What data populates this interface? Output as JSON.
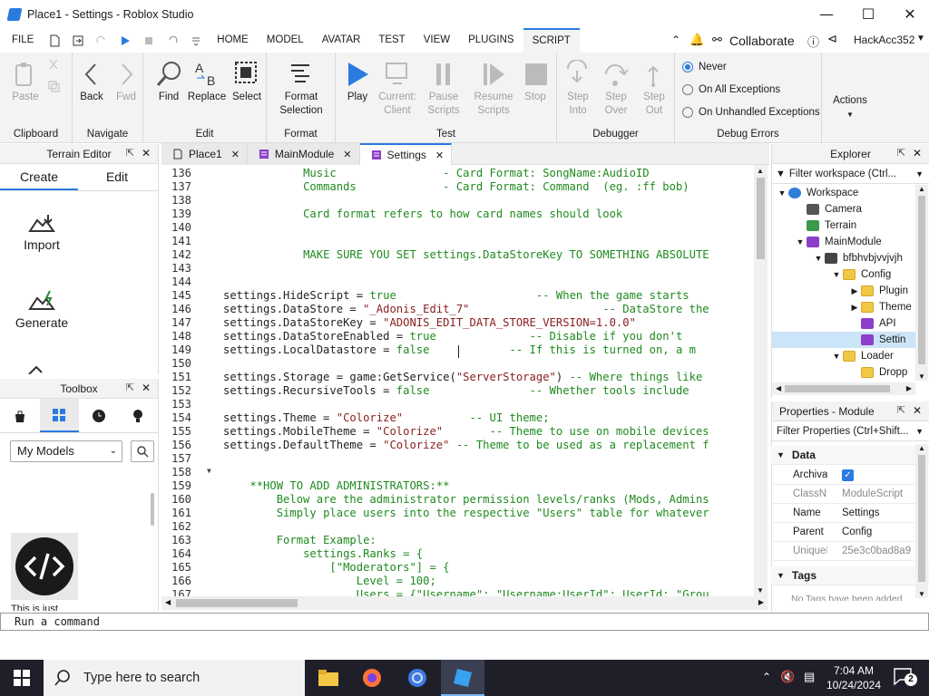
{
  "window": {
    "title": "Place1 - Settings - Roblox Studio"
  },
  "menubar": {
    "file": "FILE",
    "tabs": [
      "HOME",
      "MODEL",
      "AVATAR",
      "TEST",
      "VIEW",
      "PLUGINS",
      "SCRIPT"
    ],
    "active_tab": "SCRIPT",
    "collaborate": "Collaborate",
    "user": "HackAcc352"
  },
  "ribbon": {
    "paste": "Paste",
    "clipboard": "Clipboard",
    "back": "Back",
    "fwd": "Fwd",
    "navigate": "Navigate",
    "find": "Find",
    "replace": "Replace",
    "select": "Select",
    "edit": "Edit",
    "format_selection_1": "Format",
    "format_selection_2": "Selection",
    "format": "Format",
    "play": "Play",
    "current_client_1": "Current:",
    "current_client_2": "Client",
    "pause_scripts_1": "Pause",
    "pause_scripts_2": "Scripts",
    "resume_scripts_1": "Resume",
    "resume_scripts_2": "Scripts",
    "stop": "Stop",
    "test": "Test",
    "step_into_1": "Step",
    "step_into_2": "Into",
    "step_over_1": "Step",
    "step_over_2": "Over",
    "step_out_1": "Step",
    "step_out_2": "Out",
    "debugger": "Debugger",
    "never": "Never",
    "on_all": "On All Exceptions",
    "on_unhandled": "On Unhandled Exceptions",
    "debug_errors": "Debug Errors",
    "actions": "Actions"
  },
  "terrain": {
    "title": "Terrain Editor",
    "tab_create": "Create",
    "tab_edit": "Edit",
    "import": "Import",
    "generate": "Generate"
  },
  "toolbox": {
    "title": "Toolbox",
    "dropdown": "My Models",
    "item_caption": "This is just"
  },
  "doctabs": [
    "Place1",
    "MainModule",
    "Settings"
  ],
  "editor": {
    "lines": [
      {
        "n": "136",
        "parts": [
          [
            "pl",
            "            "
          ],
          [
            "cm",
            "Music                - Card Format: SongName:AudioID"
          ]
        ]
      },
      {
        "n": "137",
        "parts": [
          [
            "pl",
            "            "
          ],
          [
            "cm",
            "Commands             - Card Format: Command  (eg. :ff bob)"
          ]
        ]
      },
      {
        "n": "138",
        "parts": []
      },
      {
        "n": "139",
        "parts": [
          [
            "pl",
            "            "
          ],
          [
            "cm",
            "Card format refers to how card names should look"
          ]
        ]
      },
      {
        "n": "140",
        "parts": []
      },
      {
        "n": "141",
        "parts": []
      },
      {
        "n": "142",
        "parts": [
          [
            "pl",
            "            "
          ],
          [
            "cm",
            "MAKE SURE YOU SET settings.DataStoreKey TO SOMETHING ABSOLUTE"
          ]
        ]
      },
      {
        "n": "143",
        "parts": []
      },
      {
        "n": "144",
        "parts": []
      },
      {
        "n": "145",
        "parts": [
          [
            "pl",
            "settings.HideScript = "
          ],
          [
            "kw",
            "true"
          ],
          [
            "cm",
            "                     -- When the game starts"
          ]
        ]
      },
      {
        "n": "146",
        "parts": [
          [
            "pl",
            "settings.DataStore = "
          ],
          [
            "str",
            "\"_Adonis_Edit_7\""
          ],
          [
            "cm",
            "                    -- DataStore the"
          ]
        ]
      },
      {
        "n": "147",
        "parts": [
          [
            "pl",
            "settings.DataStoreKey = "
          ],
          [
            "str",
            "\"ADONIS_EDIT_DATA_STORE_VERSION=1.0.0\""
          ]
        ]
      },
      {
        "n": "148",
        "parts": [
          [
            "pl",
            "settings.DataStoreEnabled = "
          ],
          [
            "kw",
            "true"
          ],
          [
            "cm",
            "              -- Disable if you don't"
          ]
        ]
      },
      {
        "n": "149",
        "parts": [
          [
            "pl",
            "settings.LocalDatastore = "
          ],
          [
            "kw",
            "false"
          ],
          [
            "cm",
            "            -- If this is turned on, a m"
          ]
        ]
      },
      {
        "n": "150",
        "parts": []
      },
      {
        "n": "151",
        "parts": [
          [
            "pl",
            "settings.Storage = game:GetService("
          ],
          [
            "str",
            "\"ServerStorage\""
          ],
          [
            "pl",
            ")"
          ],
          [
            "cm",
            " -- Where things like"
          ]
        ]
      },
      {
        "n": "152",
        "parts": [
          [
            "pl",
            "settings.RecursiveTools = "
          ],
          [
            "kw",
            "false"
          ],
          [
            "cm",
            "               -- Whether tools include"
          ]
        ]
      },
      {
        "n": "153",
        "parts": []
      },
      {
        "n": "154",
        "parts": [
          [
            "pl",
            "settings.Theme = "
          ],
          [
            "str",
            "\"Colorize\""
          ],
          [
            "cm",
            "          -- UI theme;"
          ]
        ]
      },
      {
        "n": "155",
        "parts": [
          [
            "pl",
            "settings.MobileTheme = "
          ],
          [
            "str",
            "\"Colorize\""
          ],
          [
            "cm",
            "       -- Theme to use on mobile devices"
          ]
        ]
      },
      {
        "n": "156",
        "parts": [
          [
            "pl",
            "settings.DefaultTheme = "
          ],
          [
            "str",
            "\"Colorize\""
          ],
          [
            "cm",
            " -- Theme to be used as a replacement f"
          ]
        ]
      },
      {
        "n": "157",
        "parts": []
      },
      {
        "n": "158",
        "parts": []
      },
      {
        "n": "159",
        "parts": [
          [
            "pl",
            "    "
          ],
          [
            "cm",
            "**HOW TO ADD ADMINISTRATORS:**"
          ]
        ]
      },
      {
        "n": "160",
        "parts": [
          [
            "pl",
            "        "
          ],
          [
            "cm",
            "Below are the administrator permission levels/ranks (Mods, Admins"
          ]
        ]
      },
      {
        "n": "161",
        "parts": [
          [
            "pl",
            "        "
          ],
          [
            "cm",
            "Simply place users into the respective \"Users\" table for whatever"
          ]
        ]
      },
      {
        "n": "162",
        "parts": []
      },
      {
        "n": "163",
        "parts": [
          [
            "pl",
            "        "
          ],
          [
            "cm",
            "Format Example:"
          ]
        ]
      },
      {
        "n": "164",
        "parts": [
          [
            "pl",
            "            "
          ],
          [
            "cm",
            "settings.Ranks = {"
          ]
        ]
      },
      {
        "n": "165",
        "parts": [
          [
            "pl",
            "                "
          ],
          [
            "cm",
            "[\"Moderators\"] = {"
          ]
        ]
      },
      {
        "n": "166",
        "parts": [
          [
            "pl",
            "                    "
          ],
          [
            "cm",
            "Level = 100;"
          ]
        ]
      },
      {
        "n": "167",
        "parts": [
          [
            "pl",
            "                    "
          ],
          [
            "cm",
            "Users = {\"Username\"; \"Username:UserId\"; UserId; \"Grou"
          ]
        ]
      }
    ]
  },
  "explorer": {
    "title": "Explorer",
    "filter": "Filter workspace (Ctrl...",
    "items": [
      "Workspace",
      "Camera",
      "Terrain",
      "MainModule",
      "bfbhvbjvvjvjh",
      "Config",
      "Plugin",
      "Theme",
      "API",
      "Settin",
      "Loader",
      "Dropp"
    ]
  },
  "properties": {
    "title": "Properties - ModuleScript \"Settings\"",
    "filter": "Filter Properties (Ctrl+Shift...",
    "section_data": "Data",
    "section_tags": "Tags",
    "rows": [
      {
        "k": "Archiva...",
        "v": ""
      },
      {
        "k": "ClassN...",
        "v": "ModuleScript"
      },
      {
        "k": "Name",
        "v": "Settings"
      },
      {
        "k": "Parent",
        "v": "Config"
      },
      {
        "k": "UniqueId",
        "v": "25e3c0bad8a9"
      }
    ],
    "tags_hint": "No Tags have been added"
  },
  "command": {
    "placeholder": "Run a command"
  },
  "taskbar": {
    "search": "Type here to search",
    "time": "7:04 AM",
    "date": "10/24/2024",
    "notif": "2"
  }
}
